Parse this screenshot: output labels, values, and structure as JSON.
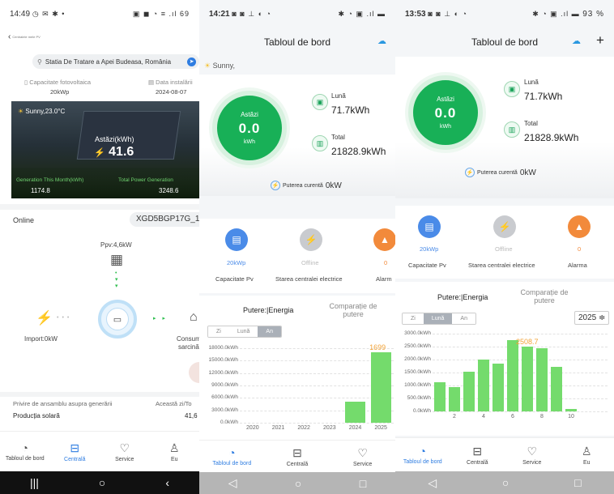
{
  "phone1": {
    "status": {
      "time": "14:49",
      "left_icons": "◷ ✉ ✱ •",
      "right_icons": "▣ ◼ ◔ ≡ .ıl 69"
    },
    "back_label": "Centralele mele PV",
    "location": "Statia De Tratare a Apei Budeasa, România",
    "capacity_label": "Capacitate fotovoltaica",
    "capacity_value": "20kWp",
    "install_label": "Data instalării",
    "install_value": "2024-08-07",
    "weather": "Sunny,23.0°C",
    "today_label": "Astăzi(kWh)",
    "today_value": "41.6",
    "month_label": "Generation This Month(kWh)",
    "month_value": "1174.8",
    "total_label": "Total Power Generation",
    "total_value": "3248.6",
    "online_label": "Online",
    "device_id": "XGD5BGP17G_1",
    "ppv": "Ppv:4,6kW",
    "import": "Import:0kW",
    "consume_1": "Consum",
    "consume_2": "sarcină",
    "overview_label": "Privire de ansamblu asupra generării",
    "overview_right": "Această zi/To",
    "solar_label": "Producția solară",
    "solar_value": "41,6",
    "tabs": [
      "Tabloul de bord",
      "Centrală",
      "Service",
      "Eu"
    ],
    "active_tab": 1
  },
  "phone2": {
    "status": {
      "time": "14:21",
      "left_icons": "◙ ◙ ⊥ ◐ ◔",
      "right_icons": "✱ ◔ ▣ .ıl ▬"
    },
    "title": "Tabloul de bord",
    "weather": "Sunny,",
    "gauge_label": "Astăzi",
    "gauge_value": "0.0",
    "gauge_unit": "kWh",
    "month_label": "Lună",
    "month_value": "71.7kWh",
    "total_label": "Total",
    "total_value": "21828.9kWh",
    "current_power_label": "Puterea curentă",
    "current_power_value": "0kW",
    "cap_value": "20kWp",
    "cap_label": "Capacitate Pv",
    "state_value": "Offline",
    "state_label": "Starea centralei electrice",
    "alarm_value": "0",
    "alarm_label": "Alarm",
    "tab_power": "Putere:|Energia",
    "tab_compare": "Comparație de putere",
    "seg": [
      "Zi",
      "Lună",
      "An"
    ],
    "seg_active": 2,
    "bar_label": "1699",
    "tabs": [
      "Tabloul de bord",
      "Centrală",
      "Service"
    ],
    "active_tab": 0
  },
  "phone3": {
    "status": {
      "time": "13:53",
      "left_icons": "◙ ◙ ⊥ ◐ ◔",
      "right_icons": "✱ ◔ ▣ .ıl ▬",
      "battery": "93 %"
    },
    "title": "Tabloul de bord",
    "plus": "+",
    "gauge_label": "Astăzi",
    "gauge_value": "0.0",
    "gauge_unit": "kWh",
    "month_label": "Lună",
    "month_value": "71.7kWh",
    "total_label": "Total",
    "total_value": "21828.9kWh",
    "current_power_label": "Puterea curentă",
    "current_power_value": "0kW",
    "cap_value": "20kWp",
    "cap_label": "Capacitate Pv",
    "state_value": "Offline",
    "state_label": "Starea centralei electrice",
    "alarm_value": "0",
    "alarm_label": "Alarma",
    "tab_power": "Putere:|Energia",
    "tab_compare": "Comparație de putere",
    "seg": [
      "Zi",
      "Lună",
      "An"
    ],
    "seg_active": 1,
    "year_select": "2025 ≑",
    "bar_label": "2508.7",
    "tabs": [
      "Tabloul de bord",
      "Centrală",
      "Service",
      "Eu"
    ],
    "active_tab": 0
  },
  "colors": {
    "green": "#18b057",
    "blue": "#2f7de1",
    "bar": "#74db6c",
    "orange": "#f28a3b"
  },
  "chart_data": [
    {
      "type": "bar",
      "categories": [
        "2020",
        "2021",
        "2022",
        "2023",
        "2024",
        "2025"
      ],
      "values": [
        0,
        0,
        0,
        0,
        5000,
        16990
      ],
      "xlabel": "",
      "ylabel": "",
      "ylim": [
        0,
        18000
      ],
      "yticks": [
        "18000.0kWh",
        "15000.0kWh",
        "12000.0kWh",
        "9000.0kWh",
        "6000.0kWh",
        "3000.0kWh",
        "0.0kWh"
      ],
      "grid": true
    },
    {
      "type": "bar",
      "categories": [
        "1",
        "2",
        "3",
        "4",
        "5",
        "6",
        "7",
        "8",
        "9",
        "10",
        "11",
        "12"
      ],
      "values": [
        1130,
        940,
        1520,
        2010,
        1840,
        2750,
        2508.7,
        2430,
        1730,
        80,
        0,
        0
      ],
      "xticks": [
        "2",
        "4",
        "6",
        "8",
        "10"
      ],
      "ylim": [
        0,
        3000
      ],
      "yticks": [
        "3000.0kWh",
        "2500.0kWh",
        "2000.0kWh",
        "1500.0kWh",
        "1000.0kWh",
        "500.0kWh",
        "0.0kWh"
      ],
      "grid": true
    }
  ]
}
